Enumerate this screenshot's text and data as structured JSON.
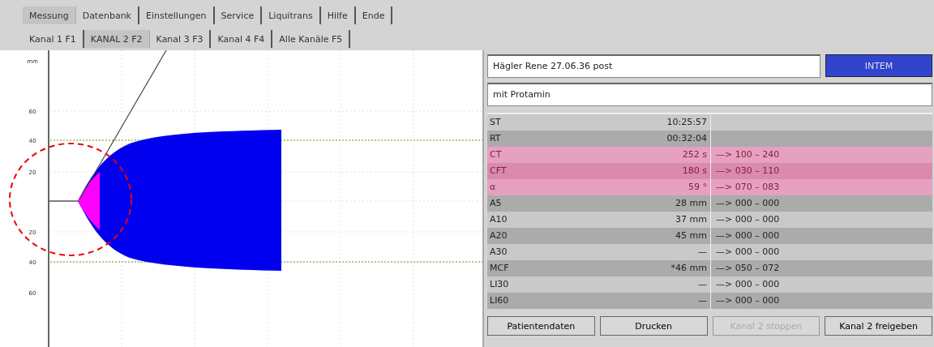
{
  "main_tabs": [
    {
      "label": "Messung",
      "selected": true
    },
    {
      "label": "Datenbank",
      "selected": false
    },
    {
      "label": "Einstellungen",
      "selected": false
    },
    {
      "label": "Service",
      "selected": false
    },
    {
      "label": "Liquitrans",
      "selected": false
    },
    {
      "label": "Hilfe",
      "selected": false
    },
    {
      "label": "Ende",
      "selected": false
    }
  ],
  "channel_tabs": [
    {
      "label": "Kanal 1 F1",
      "selected": false
    },
    {
      "label": "KANAL 2 F2",
      "selected": true
    },
    {
      "label": "Kanal 3 F3",
      "selected": false
    },
    {
      "label": "Kanal 4 F4",
      "selected": false
    },
    {
      "label": "Alle Kanäle F5",
      "selected": false
    }
  ],
  "chart": {
    "y_labels": [
      "mm",
      "60",
      "40",
      "20",
      "20",
      "40",
      "60"
    ]
  },
  "patient": {
    "name": "Hägler Rene 27.06.36 post",
    "test_button": "INTEM",
    "comment": "mit Protamin"
  },
  "results": [
    {
      "name": "ST",
      "value": "10:25:57",
      "flagged": false
    },
    {
      "name": "RT",
      "value": "00:32:04",
      "flagged": false
    },
    {
      "name": "CT",
      "value": "252 s",
      "range": "—> 100 – 240",
      "flagged": true
    },
    {
      "name": "CFT",
      "value": "180 s",
      "range": "—> 030 – 110",
      "flagged": true
    },
    {
      "name": "α",
      "value": "59 °",
      "range": "—> 070 – 083",
      "flagged": true
    },
    {
      "name": "A5",
      "value": "28 mm",
      "range": "—> 000 – 000",
      "flagged": false
    },
    {
      "name": "A10",
      "value": "37 mm",
      "range": "—> 000 – 000",
      "flagged": false
    },
    {
      "name": "A20",
      "value": "45 mm",
      "range": "—> 000 – 000",
      "flagged": false
    },
    {
      "name": "A30",
      "value": "—",
      "range": "—> 000 – 000",
      "flagged": false
    },
    {
      "name": "MCF",
      "value": "*46 mm",
      "range": "—> 050 – 072",
      "flagged": false
    },
    {
      "name": "LI30",
      "value": "—",
      "range": "—> 000 – 000",
      "flagged": false
    },
    {
      "name": "LI60",
      "value": "—",
      "range": "—> 000 – 000",
      "flagged": false
    }
  ],
  "buttons": [
    {
      "label": "Patientendaten",
      "disabled": false
    },
    {
      "label": "Drucken",
      "disabled": false
    },
    {
      "label": "Kanal 2 stoppen",
      "disabled": true
    },
    {
      "label": "Kanal 2 freigeben",
      "disabled": false
    }
  ]
}
